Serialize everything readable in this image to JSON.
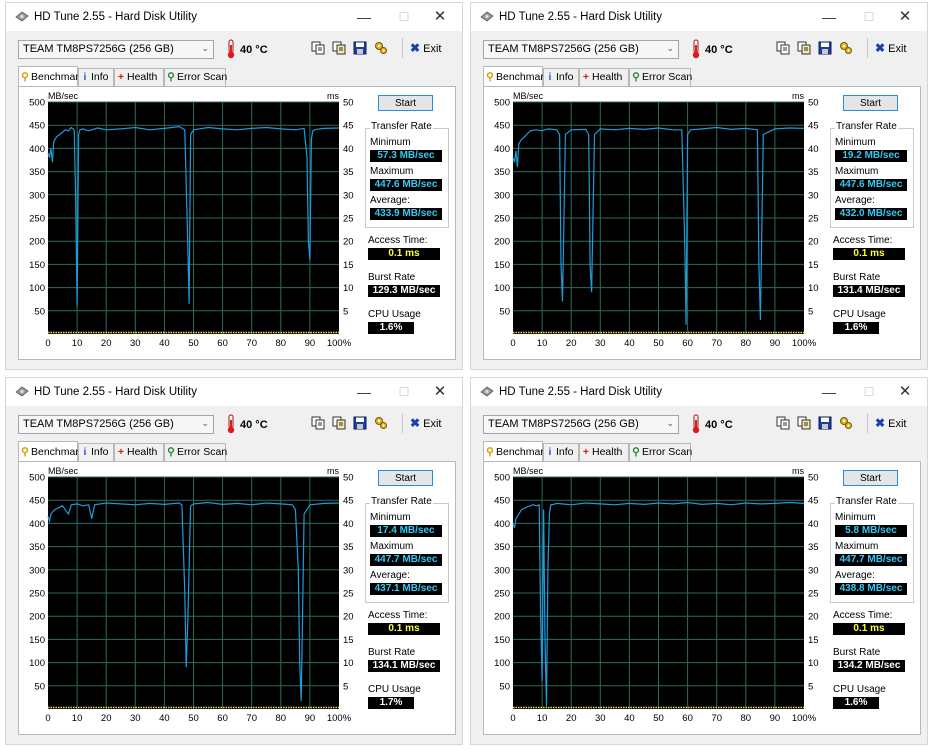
{
  "common": {
    "title": "HD Tune 2.55 - Hard Disk Utility",
    "min_glyph": "—",
    "max_glyph": "☐",
    "close_glyph": "✕",
    "drive": "TEAM    TM8PS7256G (256 GB)",
    "temperature": "40 °C",
    "exit_label": "Exit",
    "tabs": [
      "Benchmark",
      "Info",
      "Health",
      "Error Scan"
    ],
    "start_label": "Start",
    "mbsec_label": "MB/sec",
    "ms_label": "ms",
    "transfer_rate_label": "Transfer Rate",
    "minimum_label": "Minimum",
    "maximum_label": "Maximum",
    "average_label": "Average:",
    "access_time_label": "Access Time:",
    "burst_rate_label": "Burst Rate",
    "cpu_usage_label": "CPU Usage",
    "icons": {
      "app": "hard-drive-icon",
      "thermometer": "thermometer-icon",
      "copy": "copy-icon",
      "copy_alt": "copy-text-icon",
      "save": "save-icon",
      "options": "options-icon",
      "exit": "exit-icon",
      "benchmark": "benchmark-icon",
      "info": "info-icon",
      "health": "health-icon",
      "error_scan": "error-scan-icon"
    },
    "colors": {
      "graph_bg": "#000000",
      "grid": "#2d6b5a",
      "transfer_line": "#1f9bd8",
      "access_dots": "#f0e23c",
      "cyan_value": "#33c9f5",
      "yellow_value": "#ffff33"
    }
  },
  "windows": [
    {
      "minimum": "57.3 MB/sec",
      "maximum": "447.6 MB/sec",
      "average": "433.9 MB/sec",
      "access_time": "0.1 ms",
      "burst_rate": "129.3 MB/sec",
      "cpu_usage": "1.6%",
      "chart_data": {
        "type": "line",
        "x": [
          0,
          0.5,
          1,
          1.5,
          2,
          3,
          4,
          5,
          6,
          7,
          8,
          9,
          9.5,
          10,
          10.5,
          11,
          12,
          14,
          17,
          20,
          25,
          30,
          35,
          40,
          45,
          47,
          48,
          48.5,
          49,
          50,
          55,
          60,
          65,
          70,
          75,
          80,
          85,
          88,
          89,
          89.5,
          90,
          90.5,
          91,
          92,
          95,
          100
        ],
        "y": [
          390,
          380,
          400,
          370,
          415,
          425,
          430,
          435,
          440,
          438,
          445,
          440,
          300,
          60,
          430,
          440,
          442,
          438,
          444,
          440,
          442,
          445,
          440,
          443,
          447,
          440,
          200,
          65,
          430,
          440,
          445,
          442,
          440,
          443,
          445,
          442,
          440,
          443,
          380,
          200,
          160,
          420,
          438,
          441,
          443,
          444
        ],
        "xlabel": "",
        "ylabel": "MB/sec",
        "y2label": "ms",
        "xlim": [
          0,
          100
        ],
        "ylim": [
          0,
          500
        ],
        "y2lim": [
          0,
          50
        ],
        "x_ticks": [
          "0",
          "10",
          "20",
          "30",
          "40",
          "50",
          "60",
          "70",
          "80",
          "90",
          "100%"
        ],
        "y_ticks": [
          "50",
          "100",
          "150",
          "200",
          "250",
          "300",
          "350",
          "400",
          "450",
          "500"
        ],
        "y2_ticks": [
          "5",
          "10",
          "15",
          "20",
          "25",
          "30",
          "35",
          "40",
          "45",
          "50"
        ],
        "access_time_ms": 0.1,
        "grid": true
      }
    },
    {
      "minimum": "19.2 MB/sec",
      "maximum": "447.6 MB/sec",
      "average": "432.0 MB/sec",
      "access_time": "0.1 ms",
      "burst_rate": "131.4 MB/sec",
      "cpu_usage": "1.6%",
      "chart_data": {
        "type": "line",
        "x": [
          0,
          0.5,
          1,
          1.5,
          2,
          3,
          4,
          5,
          6,
          8,
          10,
          12,
          15,
          16,
          16.5,
          17,
          18,
          20,
          25,
          26,
          26.5,
          27,
          28,
          30,
          35,
          40,
          45,
          50,
          55,
          58,
          59,
          59.5,
          60,
          61,
          65,
          70,
          75,
          80,
          84,
          84.5,
          85,
          86,
          90,
          95,
          100
        ],
        "y": [
          380,
          370,
          395,
          360,
          410,
          420,
          425,
          432,
          438,
          440,
          438,
          442,
          440,
          430,
          150,
          70,
          430,
          440,
          441,
          430,
          150,
          90,
          430,
          442,
          440,
          443,
          441,
          444,
          440,
          440,
          200,
          20,
          430,
          440,
          442,
          445,
          441,
          443,
          440,
          150,
          30,
          430,
          442,
          444,
          443
        ],
        "xlabel": "",
        "ylabel": "MB/sec",
        "y2label": "ms",
        "xlim": [
          0,
          100
        ],
        "ylim": [
          0,
          500
        ],
        "y2lim": [
          0,
          50
        ],
        "x_ticks": [
          "0",
          "10",
          "20",
          "30",
          "40",
          "50",
          "60",
          "70",
          "80",
          "90",
          "100%"
        ],
        "y_ticks": [
          "50",
          "100",
          "150",
          "200",
          "250",
          "300",
          "350",
          "400",
          "450",
          "500"
        ],
        "y2_ticks": [
          "5",
          "10",
          "15",
          "20",
          "25",
          "30",
          "35",
          "40",
          "45",
          "50"
        ],
        "access_time_ms": 0.1,
        "grid": true
      }
    },
    {
      "minimum": "17.4 MB/sec",
      "maximum": "447.7 MB/sec",
      "average": "437.1 MB/sec",
      "access_time": "0.1 ms",
      "burst_rate": "134.1 MB/sec",
      "cpu_usage": "1.7%",
      "chart_data": {
        "type": "line",
        "x": [
          0,
          0.5,
          1,
          2,
          3,
          5,
          7,
          8,
          10,
          12,
          14,
          15,
          16,
          20,
          25,
          30,
          35,
          40,
          45,
          46,
          47,
          47.5,
          48,
          49,
          50,
          55,
          60,
          65,
          70,
          75,
          80,
          84,
          85,
          86,
          86.5,
          87,
          88,
          90,
          95,
          100
        ],
        "y": [
          415,
          405,
          420,
          428,
          432,
          438,
          420,
          440,
          442,
          438,
          440,
          410,
          440,
          444,
          442,
          440,
          443,
          441,
          444,
          440,
          250,
          90,
          180,
          438,
          442,
          445,
          441,
          443,
          440,
          444,
          442,
          440,
          430,
          300,
          100,
          17,
          420,
          440,
          443,
          444
        ],
        "xlabel": "",
        "ylabel": "MB/sec",
        "y2label": "ms",
        "xlim": [
          0,
          100
        ],
        "ylim": [
          0,
          500
        ],
        "y2lim": [
          0,
          50
        ],
        "x_ticks": [
          "0",
          "10",
          "20",
          "30",
          "40",
          "50",
          "60",
          "70",
          "80",
          "90",
          "100%"
        ],
        "y_ticks": [
          "50",
          "100",
          "150",
          "200",
          "250",
          "300",
          "350",
          "400",
          "450",
          "500"
        ],
        "y2_ticks": [
          "5",
          "10",
          "15",
          "20",
          "25",
          "30",
          "35",
          "40",
          "45",
          "50"
        ],
        "access_time_ms": 0.1,
        "grid": true
      }
    },
    {
      "minimum": "5.8 MB/sec",
      "maximum": "447.7 MB/sec",
      "average": "438.8 MB/sec",
      "access_time": "0.1 ms",
      "burst_rate": "134.2 MB/sec",
      "cpu_usage": "1.6%",
      "chart_data": {
        "type": "line",
        "x": [
          0,
          0.5,
          1,
          2,
          3,
          5,
          7,
          8,
          9,
          9.5,
          10,
          10.5,
          11,
          11.5,
          12,
          12.5,
          13,
          14,
          15,
          20,
          25,
          30,
          35,
          40,
          45,
          50,
          55,
          60,
          65,
          70,
          75,
          80,
          85,
          90,
          95,
          100
        ],
        "y": [
          400,
          390,
          410,
          420,
          430,
          436,
          440,
          438,
          440,
          200,
          60,
          430,
          150,
          6,
          300,
          420,
          440,
          441,
          443,
          440,
          444,
          442,
          440,
          443,
          441,
          444,
          442,
          445,
          441,
          443,
          440,
          444,
          442,
          443,
          445,
          443
        ],
        "xlabel": "",
        "ylabel": "MB/sec",
        "y2label": "ms",
        "xlim": [
          0,
          100
        ],
        "ylim": [
          0,
          500
        ],
        "y2lim": [
          0,
          50
        ],
        "x_ticks": [
          "0",
          "10",
          "20",
          "30",
          "40",
          "50",
          "60",
          "70",
          "80",
          "90",
          "100%"
        ],
        "y_ticks": [
          "50",
          "100",
          "150",
          "200",
          "250",
          "300",
          "350",
          "400",
          "450",
          "500"
        ],
        "y2_ticks": [
          "5",
          "10",
          "15",
          "20",
          "25",
          "30",
          "35",
          "40",
          "45",
          "50"
        ],
        "access_time_ms": 0.1,
        "grid": true
      }
    }
  ]
}
